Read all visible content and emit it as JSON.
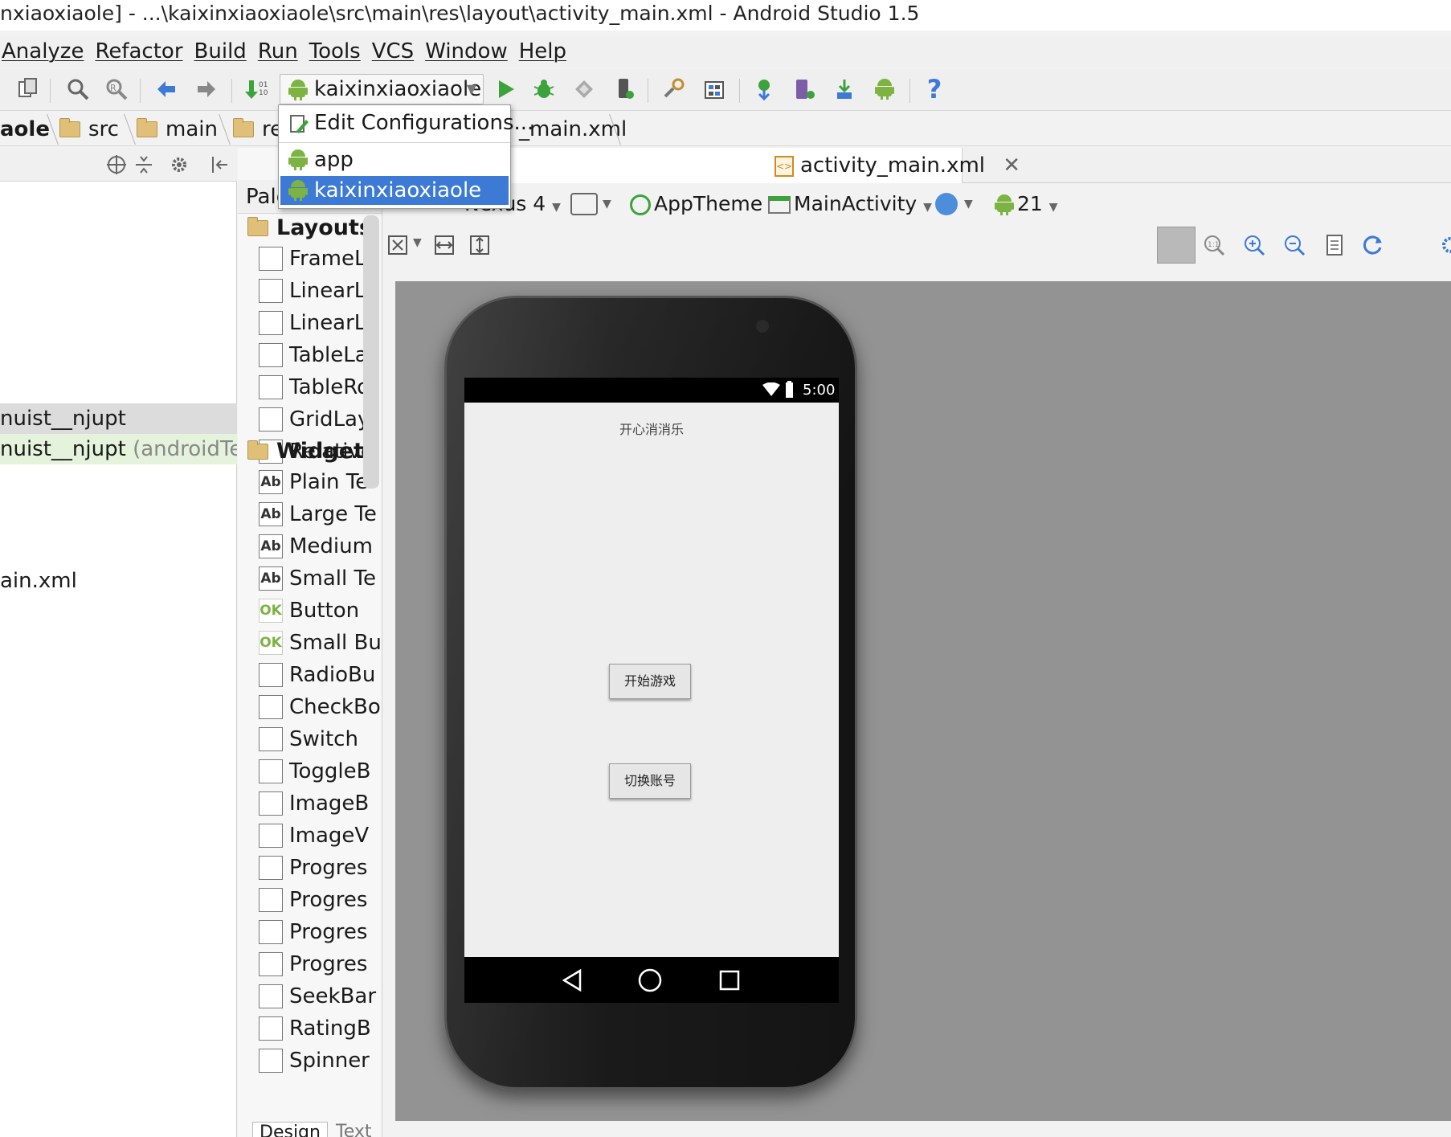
{
  "window": {
    "title": "nxiaoxiaole] - ...\\kaixinxiaoxiaole\\src\\main\\res\\layout\\activity_main.xml - Android Studio 1.5"
  },
  "menu": [
    "Analyze",
    "Refactor",
    "Build",
    "Run",
    "Tools",
    "VCS",
    "Window",
    "Help"
  ],
  "toolbar": {
    "run_config": "kaixinxiaoxiaole"
  },
  "breadcrumb": [
    "aole",
    "src",
    "main",
    "re",
    "_main.xml"
  ],
  "run_config_dropdown": {
    "items": [
      "Edit Configurations...",
      "app",
      "kaixinxiaoxiaole"
    ],
    "selected": "kaixinxiaoxiaole"
  },
  "project_tree": {
    "rows": [
      {
        "label": "nuist__njupt",
        "suffix": ""
      },
      {
        "label": "nuist__njupt",
        "suffix": "(androidTest)"
      },
      {
        "label": "ain.xml",
        "suffix": ""
      }
    ]
  },
  "palette": {
    "header": "Pale",
    "categories": [
      {
        "name": "Layouts",
        "items": [
          "FrameLa",
          "LinearLa",
          "LinearLa",
          "TableLa",
          "TableRo",
          "GridLay",
          "Relative"
        ]
      },
      {
        "name": "Widgets",
        "items": [
          "Plain Te",
          "Large Te",
          "Medium",
          "Small Te",
          "Button",
          "Small Bu",
          "RadioBu",
          "CheckBo",
          "Switch",
          "ToggleB",
          "ImageB",
          "ImageV",
          "Progres",
          "Progres",
          "Progres",
          "Progres",
          "SeekBar",
          "RatingB",
          "Spinner"
        ]
      }
    ]
  },
  "bottom_tabs": [
    "Design",
    "Text"
  ],
  "editor": {
    "tab_label": "activity_main.xml",
    "device": "Nexus 4",
    "theme": "AppTheme",
    "activity": "MainActivity",
    "api_level": "21"
  },
  "device_preview": {
    "status_time": "5:00",
    "app_title": "开心消消乐",
    "buttons": [
      "开始游戏",
      "切换账号"
    ]
  }
}
